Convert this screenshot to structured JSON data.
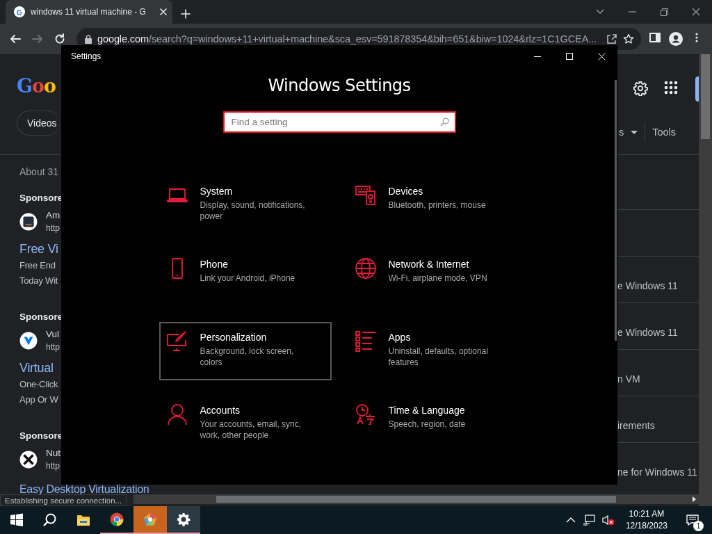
{
  "browser": {
    "tabs": [
      {
        "title": "windows 11 virtual machine - G",
        "selected": true
      }
    ],
    "nav_buttons": [
      {
        "kind": "back",
        "disabled": false
      },
      {
        "kind": "forward",
        "disabled": true
      },
      {
        "kind": "reload",
        "disabled": false
      }
    ],
    "address": {
      "host": "google.com",
      "path": "/search?q=windows+11+virtual+machine&sca_esv=591878354&bih=651&biw=1024&rlz=1C1GCEA..."
    },
    "status": "Establishing secure connection..."
  },
  "search_page": {
    "logo": "Goo",
    "chip": "Videos",
    "filter_fragment": "s",
    "tools": "Tools",
    "result_stats": "About 31",
    "ads": [
      {
        "label": "Sponsore",
        "kind": "aws",
        "site": "Am",
        "url": "http",
        "title": "Free Vi",
        "description": [
          "Free End",
          "Today Wit"
        ]
      },
      {
        "label": "Sponsore",
        "kind": "vultr",
        "site": "Vul",
        "url": "http",
        "title": "Virtual",
        "description": [
          "One-Click",
          "App Or W"
        ]
      },
      {
        "label": "Sponsore",
        "kind": "nutanix",
        "site": "Nut",
        "url": "http",
        "title": "Easy Desktop Virtualization"
      }
    ],
    "side_results": [
      "e Windows 11",
      "e Windows 11",
      "n VM",
      "irements",
      "ne for Windows 11"
    ]
  },
  "settings_window": {
    "title": "Settings",
    "heading": "Windows Settings",
    "search": {
      "placeholder": "Find a setting"
    },
    "tiles": [
      {
        "kind": "system",
        "title": "System",
        "subtitle": "Display, sound, notifications, power",
        "selected": false
      },
      {
        "kind": "devices",
        "title": "Devices",
        "subtitle": "Bluetooth, printers, mouse",
        "selected": false
      },
      {
        "kind": "phone",
        "title": "Phone",
        "subtitle": "Link your Android, iPhone",
        "selected": false
      },
      {
        "kind": "network",
        "title": "Network & Internet",
        "subtitle": "Wi-Fi, airplane mode, VPN",
        "selected": false
      },
      {
        "kind": "personalization",
        "title": "Personalization",
        "subtitle": "Background, lock screen, colors",
        "selected": true
      },
      {
        "kind": "apps",
        "title": "Apps",
        "subtitle": "Uninstall, defaults, optional features",
        "selected": false
      },
      {
        "kind": "accounts",
        "title": "Accounts",
        "subtitle": "Your accounts, email, sync, work, other people",
        "selected": false
      },
      {
        "kind": "time",
        "title": "Time & Language",
        "subtitle": "Speech, region, date",
        "selected": false
      }
    ]
  },
  "taskbar": {
    "apps": [
      {
        "kind": "start",
        "running": false,
        "active": false
      },
      {
        "kind": "search",
        "running": false,
        "active": false
      },
      {
        "kind": "explorer",
        "running": false,
        "active": false
      },
      {
        "kind": "chrome",
        "running": true,
        "active": false
      },
      {
        "kind": "polygon-app",
        "running": true,
        "active": true
      },
      {
        "kind": "settings",
        "running": true,
        "active": false
      }
    ],
    "time": "10:21 AM",
    "date": "12/18/2023",
    "notifications": "1"
  }
}
